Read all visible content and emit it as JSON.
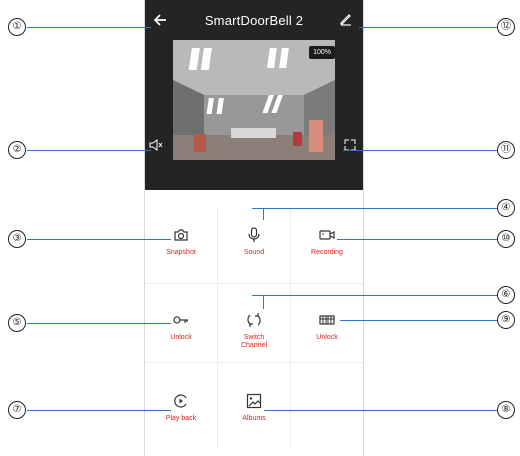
{
  "app": {
    "title": "SmartDoorBell 2",
    "zoom": "100%"
  },
  "controls": {
    "snapshot": "Snapshot",
    "sound": "Sound",
    "recording": "Recording",
    "unlock_left": "Unlock",
    "switch_line1": "Switch",
    "switch_line2": "Channel",
    "unlock_right": "Unlock",
    "playback": "Play back",
    "albums": "Albums"
  },
  "callouts": {
    "c1": "①",
    "c2": "②",
    "c3": "③",
    "c4": "④",
    "c5": "⑤",
    "c6": "⑥",
    "c7": "⑦",
    "c8": "⑧",
    "c9": "⑨",
    "c10": "⑩",
    "c11": "⑪",
    "c12": "⑫"
  },
  "colors": {
    "accent": "#e02020",
    "callout_line": "#2d74c9",
    "dark": "#242424"
  }
}
